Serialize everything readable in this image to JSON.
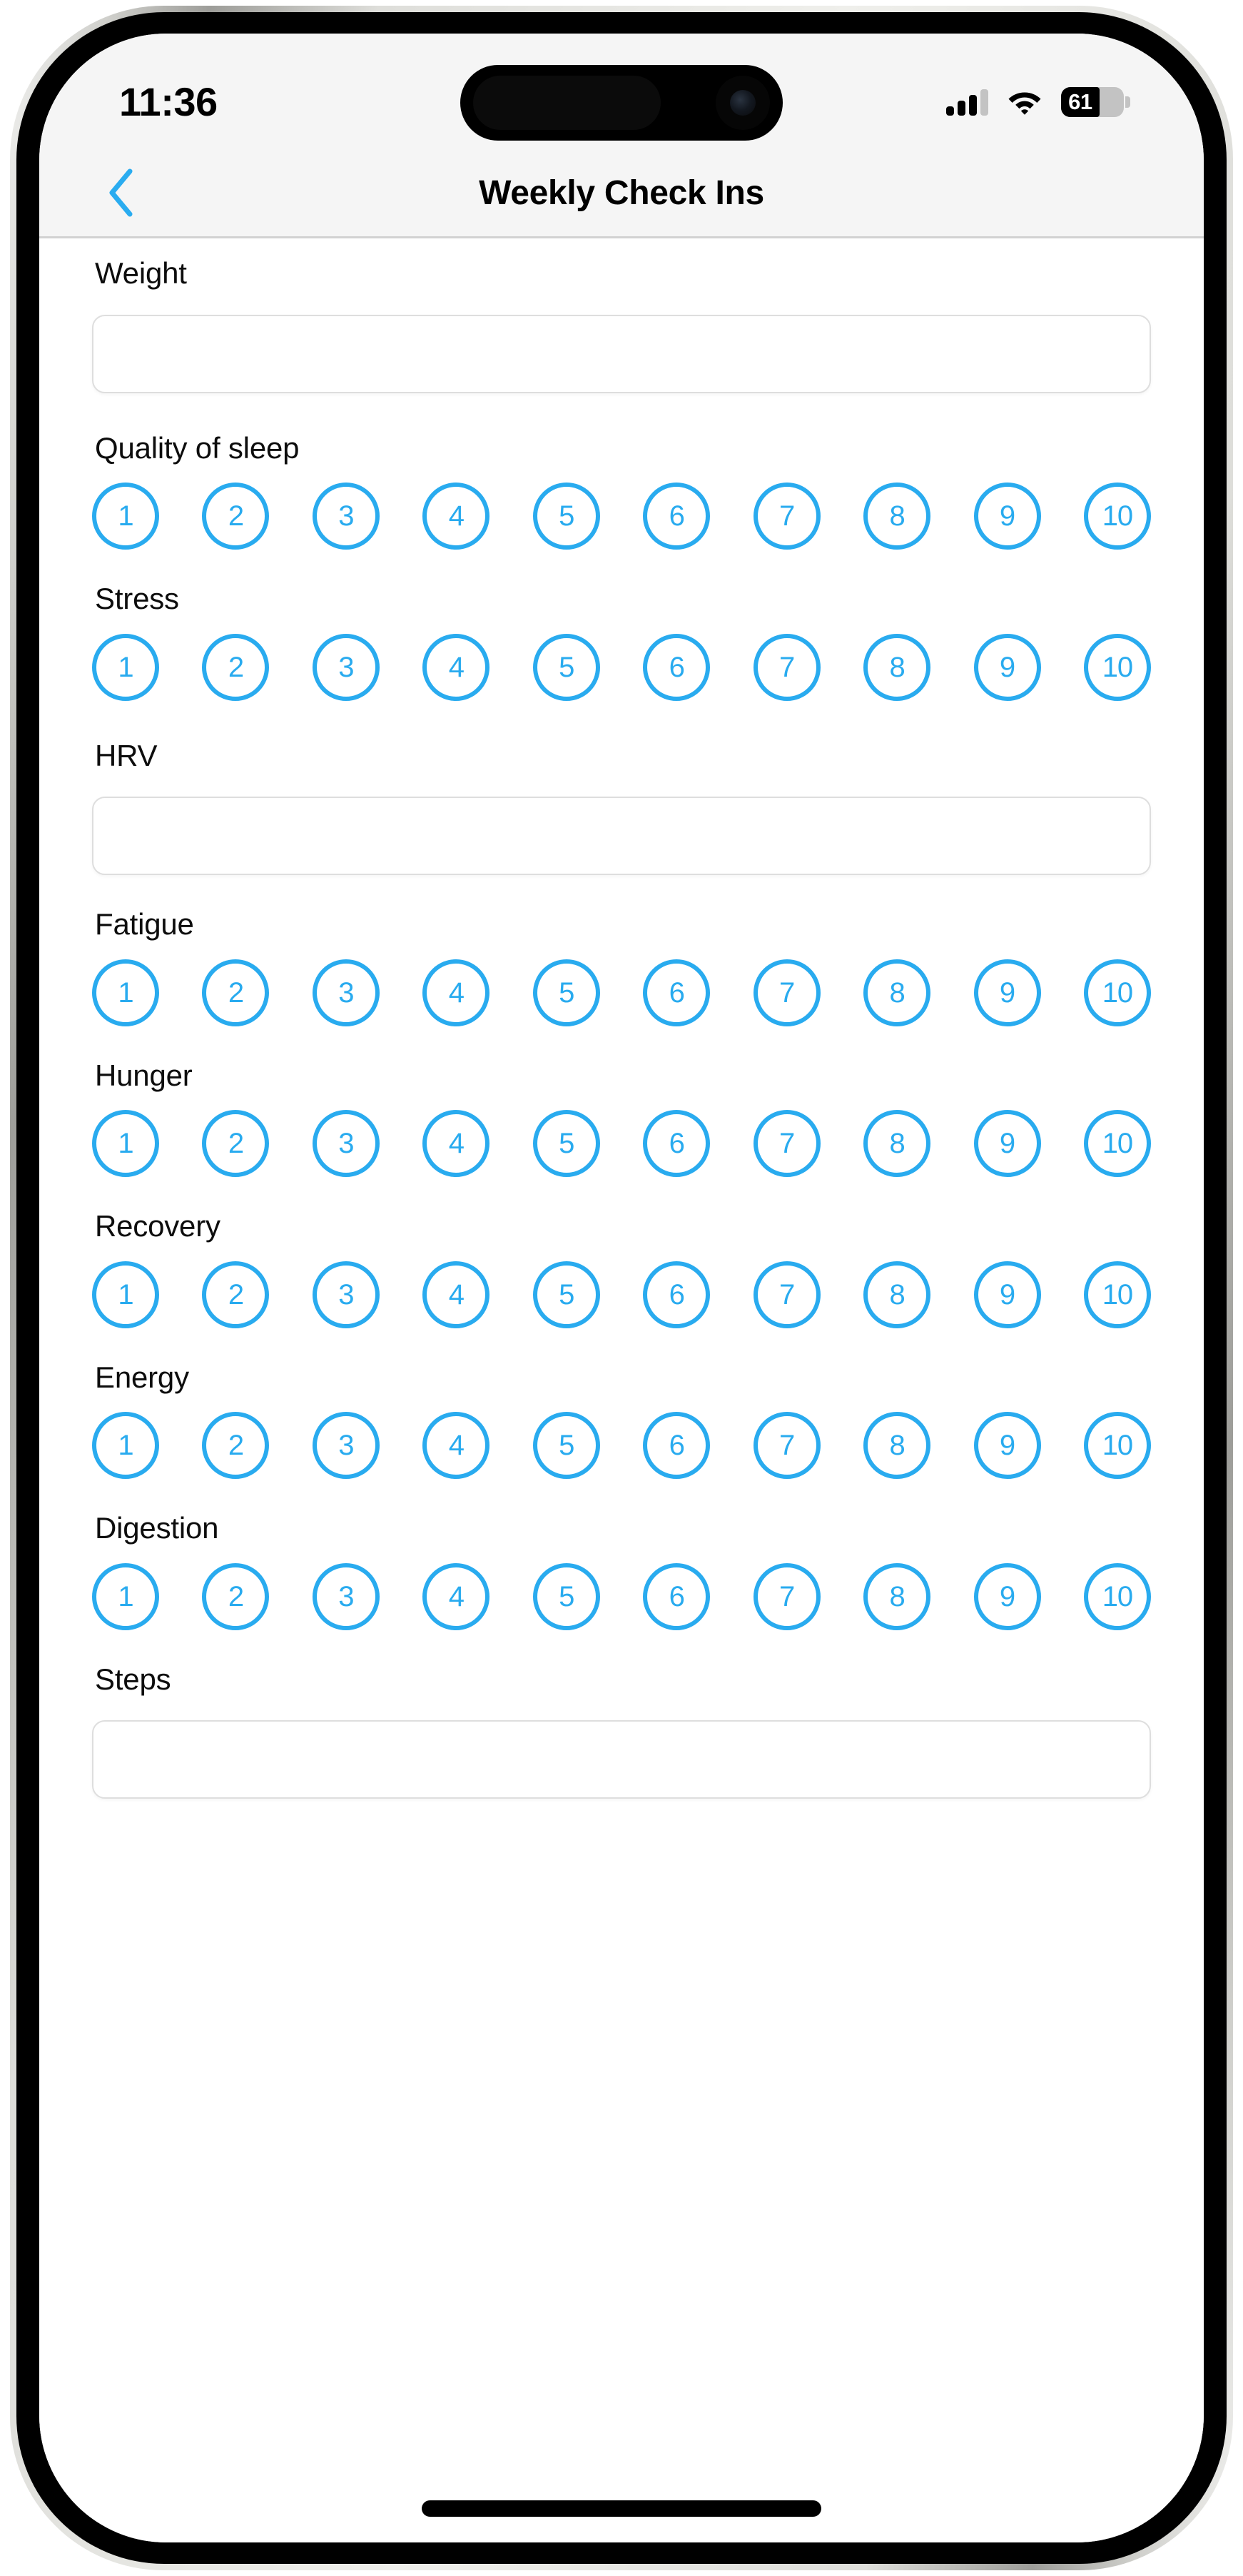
{
  "status_bar": {
    "time": "11:36",
    "cellular_icon": "cellular-signal-icon",
    "cellular_bars_filled": 3,
    "cellular_bars_total": 4,
    "wifi_icon": "wifi-icon",
    "battery_icon": "battery-icon",
    "battery_percent": "61",
    "battery_level_ratio": 0.61
  },
  "nav": {
    "back_icon": "chevron-left-icon",
    "title": "Weekly Check Ins"
  },
  "colors": {
    "accent_blue": "#29ABEF",
    "back_chevron_blue": "#2AACF0",
    "status_bar_bg": "#F5F5F5",
    "content_bg": "#FFFFFF",
    "input_border": "#DEDEDE",
    "label_text": "#0D0D0D",
    "nav_divider": "#D2D2D2"
  },
  "rating_scale": [
    "1",
    "2",
    "3",
    "4",
    "5",
    "6",
    "7",
    "8",
    "9",
    "10"
  ],
  "form": {
    "fields": [
      {
        "label": "Weight",
        "type": "text",
        "value": "",
        "placeholder": ""
      },
      {
        "label": "Quality of sleep",
        "type": "rating",
        "value": ""
      },
      {
        "label": "Stress",
        "type": "rating",
        "value": ""
      },
      {
        "label": "HRV",
        "type": "text",
        "value": "",
        "placeholder": ""
      },
      {
        "label": "Fatigue",
        "type": "rating",
        "value": ""
      },
      {
        "label": "Hunger",
        "type": "rating",
        "value": ""
      },
      {
        "label": "Recovery",
        "type": "rating",
        "value": ""
      },
      {
        "label": "Energy",
        "type": "rating",
        "value": ""
      },
      {
        "label": "Digestion",
        "type": "rating",
        "value": ""
      },
      {
        "label": "Steps",
        "type": "text",
        "value": "",
        "placeholder": ""
      }
    ]
  },
  "home_indicator": "home-indicator"
}
